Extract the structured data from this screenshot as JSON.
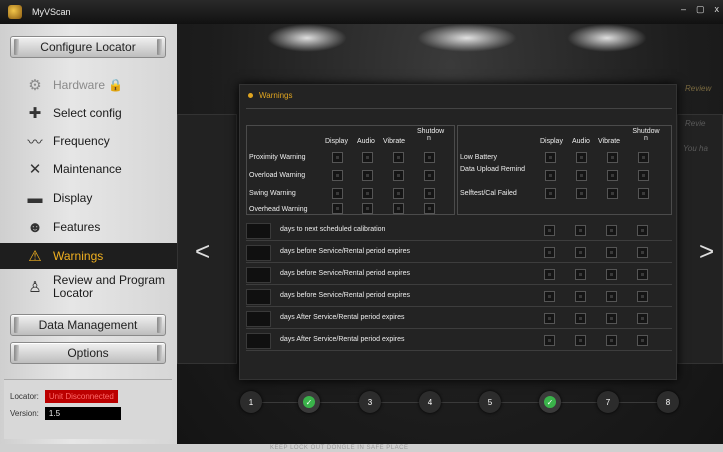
{
  "window": {
    "title": "MyVScan",
    "controls": [
      "–",
      "▢",
      "x"
    ]
  },
  "sidebar": {
    "configure_label": "Configure Locator",
    "items": [
      {
        "label": "Hardware",
        "icon": "hardware-icon",
        "state": "disabled",
        "locked": true
      },
      {
        "label": "Select config",
        "icon": "select-config-icon",
        "state": "normal"
      },
      {
        "label": "Frequency",
        "icon": "frequency-icon",
        "state": "normal"
      },
      {
        "label": "Maintenance",
        "icon": "maintenance-icon",
        "state": "normal"
      },
      {
        "label": "Display",
        "icon": "display-icon",
        "state": "normal"
      },
      {
        "label": "Features",
        "icon": "features-icon",
        "state": "normal"
      },
      {
        "label": "Warnings",
        "icon": "warning-icon",
        "state": "active"
      },
      {
        "label": "Review and Program Locator",
        "icon": "review-program-icon",
        "state": "normal"
      }
    ],
    "data_management_label": "Data Management",
    "options_label": "Options",
    "status": {
      "locator_label": "Locator:",
      "locator_value": "Unit Disconnected",
      "version_label": "Version:",
      "version_value": "1.5"
    }
  },
  "warnings": {
    "header": "Warnings",
    "columns": [
      "Display",
      "Audio",
      "Vibrate",
      "Shutdow n"
    ],
    "left_rows": [
      "Proximity Warning",
      "Overload Warning",
      "Swing Warning",
      "Overhead Warning"
    ],
    "right_rows": [
      "Low Battery",
      "Data Upload Remind",
      "Selftest/Cal Failed"
    ],
    "day_rows": [
      "days to next scheduled calibration",
      "days before Service/Rental period expires",
      "days before Service/Rental period expires",
      "days before Service/Rental period expires",
      "days After Service/Rental period expires",
      "days After Service/Rental period expires"
    ]
  },
  "nav": {
    "prev": "<",
    "next": ">"
  },
  "stepper": {
    "steps": [
      {
        "label": "1",
        "done": false
      },
      {
        "label": "✓",
        "done": true
      },
      {
        "label": "3",
        "done": false
      },
      {
        "label": "4",
        "done": false
      },
      {
        "label": "5",
        "done": false
      },
      {
        "label": "✓",
        "done": true
      },
      {
        "label": "7",
        "done": false
      },
      {
        "label": "8",
        "done": false
      }
    ]
  },
  "side_ghost_text": {
    "right_top": "Review",
    "right_2": "Revie",
    "right_3": "You ha"
  },
  "footer_text": "KEEP LOCK OUT DONGLE IN SAFE PLACE",
  "colors": {
    "accent": "#e0a520",
    "active_text": "#f0b020",
    "success": "#3ab34a",
    "error": "#b00000"
  }
}
